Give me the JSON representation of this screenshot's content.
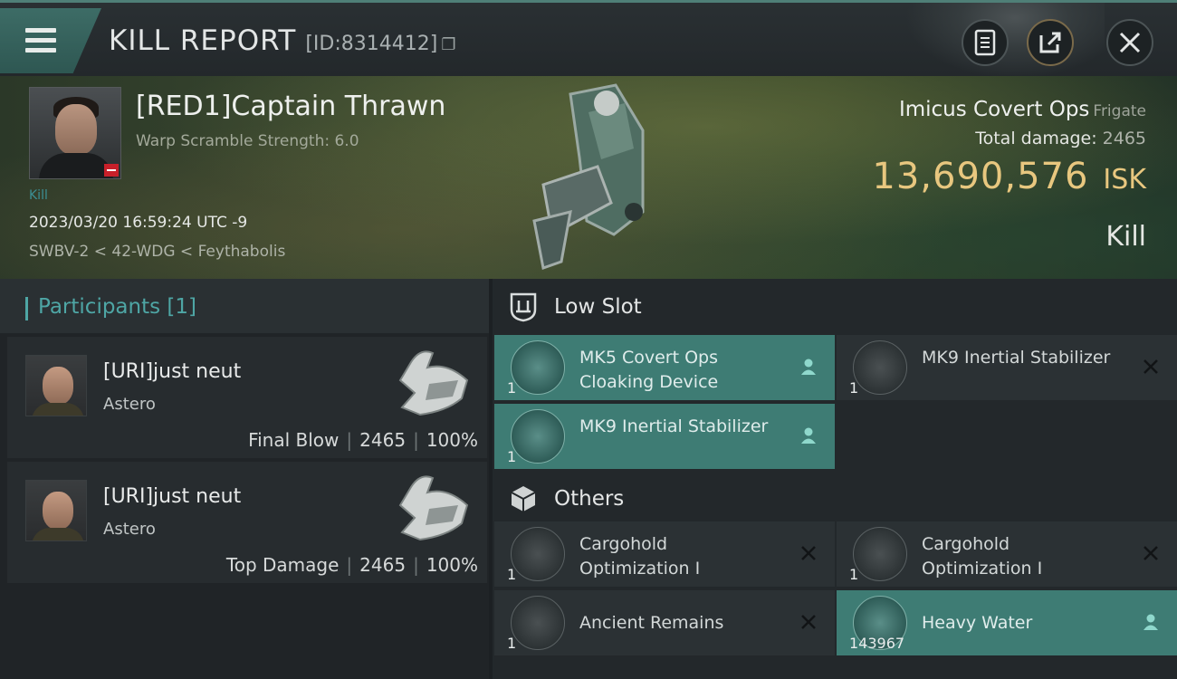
{
  "topbar": {
    "title": "KILL REPORT",
    "report_id": "[ID:8314412]",
    "icons": [
      "menu-icon",
      "copy-icon",
      "document-icon",
      "share-icon",
      "close-icon"
    ]
  },
  "victim": {
    "name": "[RED1]Captain Thrawn",
    "warp_scramble": "Warp Scramble Strength: 6.0",
    "tag": "Kill",
    "datetime": "2023/03/20 16:59:24 UTC -9",
    "location": "SWBV-2 < 42-WDG < Feythabolis",
    "ship_name": "Imicus Covert Ops",
    "ship_class": "Frigate",
    "total_damage_label": "Total damage:",
    "total_damage": "2465",
    "isk_value": "13,690,576",
    "isk_unit": "ISK",
    "kill_type": "Kill"
  },
  "participants": {
    "header": "Participants [1]",
    "list": [
      {
        "name": "[URI]just neut",
        "ship": "Astero",
        "role": "Final Blow",
        "damage": "2465",
        "percent": "100%"
      },
      {
        "name": "[URI]just neut",
        "ship": "Astero",
        "role": "Top Damage",
        "damage": "2465",
        "percent": "100%"
      }
    ]
  },
  "low_slot": {
    "header": "Low Slot",
    "items": [
      {
        "name": "MK5 Covert Ops Cloaking Device",
        "qty": "1",
        "status": "dropped",
        "icon": "cloaking-device-icon"
      },
      {
        "name": "MK9 Inertial Stabilizer",
        "qty": "1",
        "status": "destroyed",
        "icon": "inertial-stabilizer-icon"
      },
      {
        "name": "MK9 Inertial Stabilizer",
        "qty": "1",
        "status": "dropped",
        "icon": "inertial-stabilizer-icon"
      }
    ]
  },
  "others": {
    "header": "Others",
    "items": [
      {
        "name": "Cargohold Optimization I",
        "qty": "1",
        "status": "destroyed",
        "icon": "cargohold-rig-icon"
      },
      {
        "name": "Cargohold Optimization I",
        "qty": "1",
        "status": "destroyed",
        "icon": "cargohold-rig-icon"
      },
      {
        "name": "Ancient Remains",
        "qty": "1",
        "status": "destroyed",
        "icon": "remains-icon"
      },
      {
        "name": "Heavy Water",
        "qty": "143967",
        "status": "dropped",
        "icon": "heavy-water-icon"
      }
    ]
  },
  "colors": {
    "accent_teal": "#4ea6a5",
    "dropped_highlight": "#3e7c74",
    "isk_gold": "#e8c77f",
    "victim_badge_red": "#c8202a"
  }
}
